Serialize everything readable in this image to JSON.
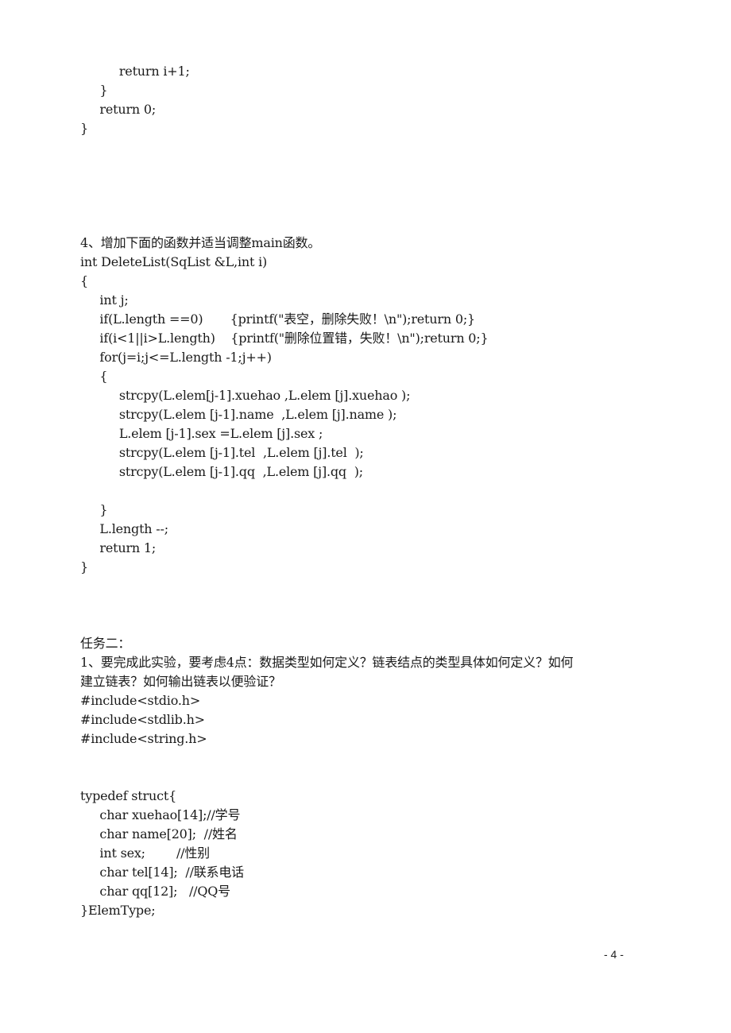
{
  "document": {
    "lines": [
      "          return i+1;",
      "     }",
      "     return 0;",
      "}",
      "4、增加下面的函数并适当调整main函数。",
      "int DeleteList(SqList &L,int i)",
      "{",
      "     int j;",
      "     if(L.length ==0)       {printf(\"表空，删除失败！\\n\");return 0;}",
      "     if(i<1||i>L.length)    {printf(\"删除位置错，失败！\\n\");return 0;}",
      "     for(j=i;j<=L.length -1;j++)",
      "     {",
      "          strcpy(L.elem[j-1].xuehao ,L.elem [j].xuehao );",
      "          strcpy(L.elem [j-1].name  ,L.elem [j].name );",
      "          L.elem [j-1].sex =L.elem [j].sex ;",
      "          strcpy(L.elem [j-1].tel  ,L.elem [j].tel  );",
      "          strcpy(L.elem [j-1].qq  ,L.elem [j].qq  );",
      "     }",
      "     L.length --;",
      "     return 1;",
      "}",
      "任务二：",
      "1、要完成此实验，要考虑4点：数据类型如何定义？链表结点的类型具体如何定义？如何",
      "建立链表？如何输出链表以便验证？",
      "#include<stdio.h>",
      "#include<stdlib.h>",
      "#include<string.h>",
      "typedef struct{",
      "     char xuehao[14];//学号",
      "     char name[20];  //姓名",
      "     int sex;        //性别",
      "     char tel[14];  //联系电话",
      "     char qq[12];   //QQ号",
      "}ElemType;"
    ],
    "page_number": "- 4 -"
  }
}
